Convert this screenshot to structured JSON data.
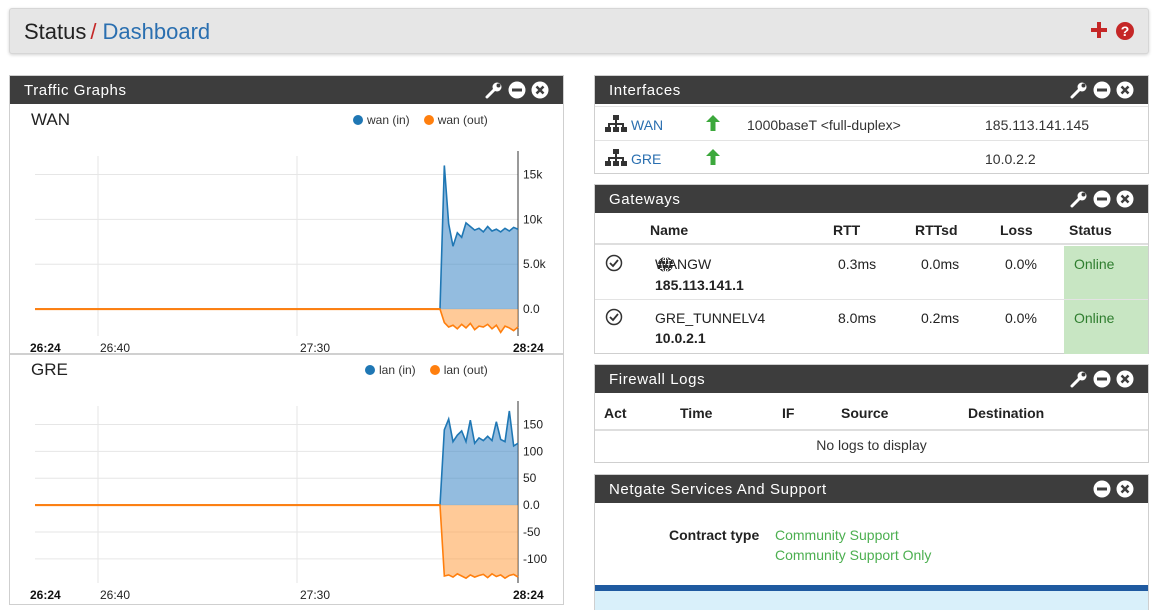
{
  "breadcrumb": {
    "root": "Status",
    "separator": "/",
    "current": "Dashboard"
  },
  "colors": {
    "accent_red": "#c52727",
    "link_blue": "#2a6fb0",
    "panel_header": "#3d3d3d",
    "series_in": "#1f77b4",
    "series_out": "#ff7f0e",
    "online_bg": "#c8e6c3"
  },
  "icons": {
    "add": "plus-icon",
    "help": "question-circle-icon",
    "settings": "wrench-icon",
    "minimize": "minus-circle-icon",
    "close": "close-circle-icon",
    "network": "sitemap-icon",
    "status_up": "arrow-up-icon",
    "gateway_ok": "check-circle-icon",
    "default_gw": "globe-icon"
  },
  "traffic": {
    "title": "Traffic Graphs",
    "graphs": [
      {
        "name": "WAN",
        "legend": [
          "wan (in)",
          "wan (out)"
        ],
        "yticks": [
          "15k",
          "10k",
          "5.0k",
          "0.0"
        ],
        "xticks": [
          "26:24",
          "26:40",
          "27:30",
          "28:24"
        ]
      },
      {
        "name": "GRE",
        "legend": [
          "lan (in)",
          "lan (out)"
        ],
        "yticks": [
          "150",
          "100",
          "50",
          "0.0",
          "-50",
          "-100"
        ],
        "xticks": [
          "26:24",
          "26:40",
          "27:30",
          "28:24"
        ]
      }
    ]
  },
  "chart_data": [
    {
      "type": "area",
      "title": "WAN",
      "series": [
        {
          "name": "wan (in)",
          "values": [
            0,
            0,
            0,
            0,
            0,
            0,
            0,
            0,
            0,
            0,
            16000,
            9500,
            7000,
            8500,
            8000,
            9600,
            9200,
            8800,
            9000,
            8600,
            9200,
            8700,
            8900,
            8600,
            9000,
            8700,
            9100,
            8900
          ]
        },
        {
          "name": "wan (out)",
          "values": [
            0,
            0,
            0,
            0,
            0,
            0,
            0,
            0,
            0,
            0,
            -1500,
            -2000,
            -1800,
            -2200,
            -1700,
            -2100,
            -1600,
            -2300,
            -1900,
            -2000,
            -1700,
            -2200,
            -1800,
            -2600,
            -1900,
            -2100,
            -2400,
            -2000
          ]
        }
      ],
      "ylim": [
        -3000,
        16500
      ],
      "grid": true,
      "legend": "top-right"
    },
    {
      "type": "area",
      "title": "GRE",
      "series": [
        {
          "name": "lan (in)",
          "values": [
            0,
            0,
            0,
            0,
            0,
            0,
            0,
            0,
            0,
            0,
            140,
            160,
            118,
            130,
            138,
            118,
            158,
            115,
            125,
            120,
            128,
            120,
            155,
            122,
            118,
            175,
            110,
            115
          ]
        },
        {
          "name": "lan (out)",
          "values": [
            0,
            0,
            0,
            0,
            0,
            0,
            0,
            0,
            0,
            0,
            -132,
            -130,
            -134,
            -128,
            -132,
            -136,
            -130,
            -134,
            -131,
            -129,
            -135,
            -128,
            -133,
            -130,
            -136,
            -131,
            -129,
            -134
          ]
        }
      ],
      "ylim": [
        -145,
        175
      ],
      "grid": true,
      "legend": "top-right"
    }
  ],
  "interfaces": {
    "title": "Interfaces",
    "rows": [
      {
        "name": "WAN",
        "media": "1000baseT <full-duplex>",
        "ip": "185.113.141.145"
      },
      {
        "name": "GRE",
        "media": "",
        "ip": "10.0.2.2"
      }
    ]
  },
  "gateways": {
    "title": "Gateways",
    "columns": [
      "Name",
      "RTT",
      "RTTsd",
      "Loss",
      "Status"
    ],
    "rows": [
      {
        "name": "WANGW",
        "addr": "185.113.141.1",
        "rtt": "0.3ms",
        "rttsd": "0.0ms",
        "loss": "0.0%",
        "status": "Online"
      },
      {
        "name": "GRE_TUNNELV4",
        "addr": "10.0.2.1",
        "rtt": "8.0ms",
        "rttsd": "0.2ms",
        "loss": "0.0%",
        "status": "Online"
      }
    ]
  },
  "firewall": {
    "title": "Firewall Logs",
    "columns": [
      "Act",
      "Time",
      "IF",
      "Source",
      "Destination"
    ],
    "empty": "No logs to display"
  },
  "netgate": {
    "title": "Netgate Services And Support",
    "contract_label": "Contract type",
    "contract_value": "Community Support",
    "contract_detail": "Community Support Only"
  }
}
